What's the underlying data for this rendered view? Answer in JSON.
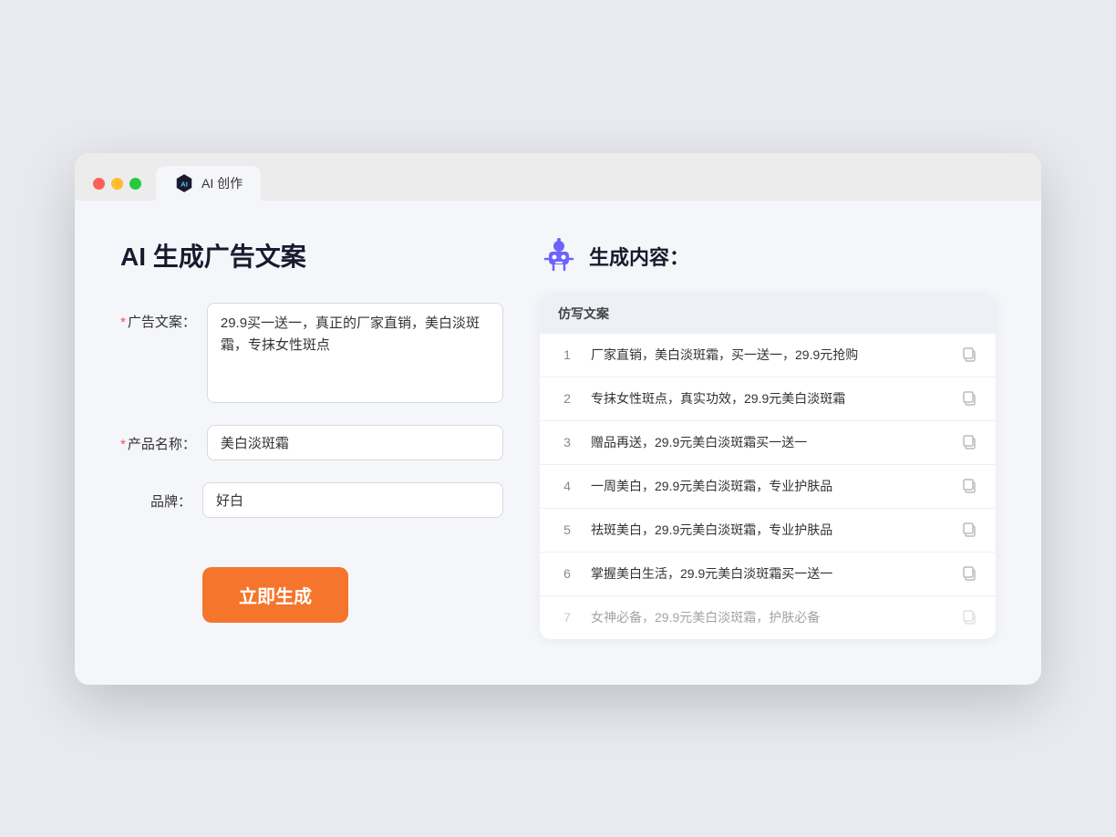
{
  "tab": {
    "label": "AI 创作"
  },
  "left": {
    "title": "AI 生成广告文案",
    "fields": [
      {
        "id": "ad-copy",
        "label": "广告文案：",
        "required": true,
        "type": "textarea",
        "value": "29.9买一送一，真正的厂家直销，美白淡斑霜，专抹女性斑点"
      },
      {
        "id": "product-name",
        "label": "产品名称：",
        "required": true,
        "type": "input",
        "value": "美白淡斑霜"
      },
      {
        "id": "brand",
        "label": "品牌：",
        "required": false,
        "type": "input",
        "value": "好白"
      }
    ],
    "button_label": "立即生成"
  },
  "right": {
    "title": "生成内容：",
    "column_header": "仿写文案",
    "results": [
      {
        "num": "1",
        "text": "厂家直销，美白淡斑霜，买一送一，29.9元抢购",
        "muted": false
      },
      {
        "num": "2",
        "text": "专抹女性斑点，真实功效，29.9元美白淡斑霜",
        "muted": false
      },
      {
        "num": "3",
        "text": "赠品再送，29.9元美白淡斑霜买一送一",
        "muted": false
      },
      {
        "num": "4",
        "text": "一周美白，29.9元美白淡斑霜，专业护肤品",
        "muted": false
      },
      {
        "num": "5",
        "text": "祛斑美白，29.9元美白淡斑霜，专业护肤品",
        "muted": false
      },
      {
        "num": "6",
        "text": "掌握美白生活，29.9元美白淡斑霜买一送一",
        "muted": false
      },
      {
        "num": "7",
        "text": "女神必备，29.9元美白淡斑霜，护肤必备",
        "muted": true
      }
    ]
  }
}
